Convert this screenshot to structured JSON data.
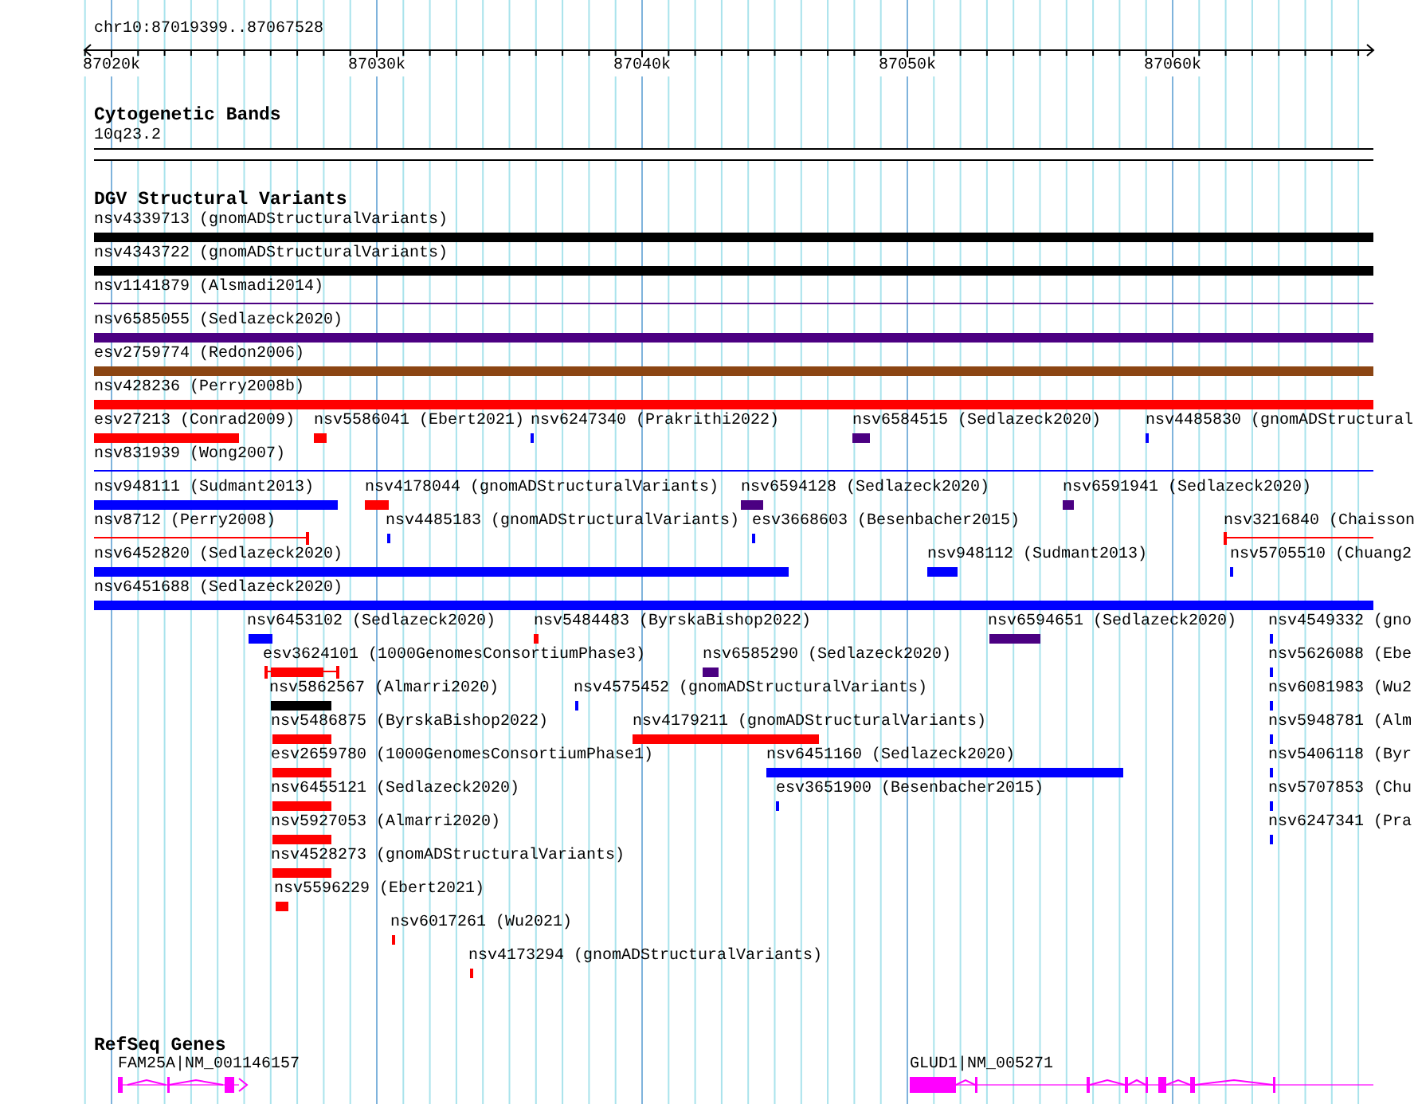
{
  "location": "chr10:87019399..87067528",
  "ruler_ticks": [
    "87020k",
    "87030k",
    "87040k",
    "87050k",
    "87060k"
  ],
  "tracks": [
    {
      "kind": "cytoband",
      "title": "Cytogenetic Bands",
      "bands": [
        {
          "label": "10q23.2"
        }
      ]
    },
    {
      "kind": "variants",
      "title": "DGV Structural Variants",
      "rows": [
        {
          "features": [
            {
              "label": "nsv4339713 (gnomADStructuralVariants)",
              "kind": "bar",
              "color": "#000000"
            }
          ]
        },
        {
          "features": [
            {
              "label": "nsv4343722 (gnomADStructuralVariants)",
              "kind": "bar",
              "color": "#000000"
            }
          ]
        },
        {
          "features": [
            {
              "label": "nsv1141879 (Alsmadi2014)",
              "kind": "line",
              "color": "#4b0082"
            }
          ]
        },
        {
          "features": [
            {
              "label": "nsv6585055 (Sedlazeck2020)",
              "kind": "bar",
              "color": "#4b0082"
            }
          ]
        },
        {
          "features": [
            {
              "label": "esv2759774 (Redon2006)",
              "kind": "bar",
              "color": "#8b4513"
            }
          ]
        },
        {
          "features": [
            {
              "label": "nsv428236 (Perry2008b)",
              "kind": "bar",
              "color": "#ff0000"
            }
          ]
        },
        {
          "features": [
            {
              "label": "esv27213 (Conrad2009)",
              "kind": "bar",
              "color": "#ff0000"
            },
            {
              "label": "nsv5586041 (Ebert2021)",
              "kind": "bar",
              "color": "#ff0000"
            },
            {
              "label": "nsv6247340 (Prakrithi2022)",
              "kind": "bar",
              "color": "#0000ff"
            },
            {
              "label": "nsv6584515 (Sedlazeck2020)",
              "kind": "bar",
              "color": "#4b0082"
            },
            {
              "label": "nsv4485830 (gnomADStructural",
              "kind": "bar",
              "color": "#0000ff"
            }
          ]
        },
        {
          "features": [
            {
              "label": "nsv831939 (Wong2007)",
              "kind": "line",
              "color": "#0000ff"
            }
          ]
        },
        {
          "features": [
            {
              "label": "nsv948111 (Sudmant2013)",
              "kind": "bar",
              "color": "#0000ff"
            },
            {
              "label": "nsv4178044 (gnomADStructuralVariants)",
              "kind": "bar",
              "color": "#ff0000"
            },
            {
              "label": "nsv6594128 (Sedlazeck2020)",
              "kind": "bar",
              "color": "#4b0082"
            },
            {
              "label": "nsv6591941 (Sedlazeck2020)",
              "kind": "bar",
              "color": "#4b0082"
            }
          ]
        },
        {
          "features": [
            {
              "label": "nsv8712 (Perry2008)",
              "kind": "capped-line",
              "color": "#ff0000"
            },
            {
              "label": "nsv4485183 (gnomADStructuralVariants)",
              "kind": "bar",
              "color": "#0000ff"
            },
            {
              "label": "esv3668603 (Besenbacher2015)",
              "kind": "bar",
              "color": "#0000ff"
            },
            {
              "label": "nsv3216840 (Chaisson",
              "kind": "capped-line",
              "color": "#ff0000"
            }
          ]
        },
        {
          "features": [
            {
              "label": "nsv6452820 (Sedlazeck2020)",
              "kind": "bar",
              "color": "#0000ff"
            },
            {
              "label": "nsv948112 (Sudmant2013)",
              "kind": "bar",
              "color": "#0000ff"
            },
            {
              "label": "nsv5705510 (Chuang2",
              "kind": "bar",
              "color": "#0000ff"
            }
          ]
        },
        {
          "features": [
            {
              "label": "nsv6451688 (Sedlazeck2020)",
              "kind": "bar",
              "color": "#0000ff"
            }
          ]
        },
        {
          "features": [
            {
              "label": "nsv6453102 (Sedlazeck2020)",
              "kind": "bar",
              "color": "#0000ff"
            },
            {
              "label": "nsv5484483 (ByrskaBishop2022)",
              "kind": "bar",
              "color": "#ff0000"
            },
            {
              "label": "nsv6594651 (Sedlazeck2020)",
              "kind": "bar",
              "color": "#4b0082"
            },
            {
              "label": "nsv4549332 (gno",
              "kind": "bar",
              "color": "#0000ff"
            }
          ]
        },
        {
          "features": [
            {
              "label": "esv3624101 (1000GenomesConsortiumPhase3)",
              "kind": "capped-bar",
              "color": "#ff0000"
            },
            {
              "label": "nsv6585290 (Sedlazeck2020)",
              "kind": "bar",
              "color": "#4b0082"
            },
            {
              "label": "nsv5626088 (Ebe",
              "kind": "bar",
              "color": "#0000ff"
            }
          ]
        },
        {
          "features": [
            {
              "label": "nsv5862567 (Almarri2020)",
              "kind": "bar",
              "color": "#000000"
            },
            {
              "label": "nsv4575452 (gnomADStructuralVariants)",
              "kind": "bar",
              "color": "#0000ff"
            },
            {
              "label": "nsv6081983 (Wu2",
              "kind": "bar",
              "color": "#0000ff"
            }
          ]
        },
        {
          "features": [
            {
              "label": "nsv5486875 (ByrskaBishop2022)",
              "kind": "bar",
              "color": "#ff0000"
            },
            {
              "label": "nsv4179211 (gnomADStructuralVariants)",
              "kind": "bar",
              "color": "#ff0000"
            },
            {
              "label": "nsv5948781 (Alm",
              "kind": "bar",
              "color": "#0000ff"
            }
          ]
        },
        {
          "features": [
            {
              "label": "esv2659780 (1000GenomesConsortiumPhase1)",
              "kind": "bar",
              "color": "#ff0000"
            },
            {
              "label": "nsv6451160 (Sedlazeck2020)",
              "kind": "bar",
              "color": "#0000ff"
            },
            {
              "label": "nsv5406118 (Byr",
              "kind": "bar",
              "color": "#0000ff"
            }
          ]
        },
        {
          "features": [
            {
              "label": "nsv6455121 (Sedlazeck2020)",
              "kind": "bar",
              "color": "#ff0000"
            },
            {
              "label": "esv3651900 (Besenbacher2015)",
              "kind": "bar",
              "color": "#0000ff"
            },
            {
              "label": "nsv5707853 (Chu",
              "kind": "bar",
              "color": "#0000ff"
            }
          ]
        },
        {
          "features": [
            {
              "label": "nsv5927053 (Almarri2020)",
              "kind": "bar",
              "color": "#ff0000"
            },
            {
              "label": "nsv6247341 (Pra",
              "kind": "bar",
              "color": "#0000ff"
            }
          ]
        },
        {
          "features": [
            {
              "label": "nsv4528273 (gnomADStructuralVariants)",
              "kind": "bar",
              "color": "#ff0000"
            }
          ]
        },
        {
          "features": [
            {
              "label": "nsv5596229 (Ebert2021)",
              "kind": "bar",
              "color": "#ff0000"
            }
          ]
        },
        {
          "features": [
            {
              "label": "nsv6017261 (Wu2021)",
              "kind": "bar",
              "color": "#ff0000"
            }
          ]
        },
        {
          "features": [
            {
              "label": "nsv4173294 (gnomADStructuralVariants)",
              "kind": "bar",
              "color": "#ff0000"
            }
          ]
        }
      ]
    },
    {
      "kind": "genes",
      "title": "RefSeq Genes",
      "genes": [
        {
          "label": "FAM25A|NM_001146157"
        },
        {
          "label": "GLUD1|NM_005271"
        }
      ]
    }
  ]
}
